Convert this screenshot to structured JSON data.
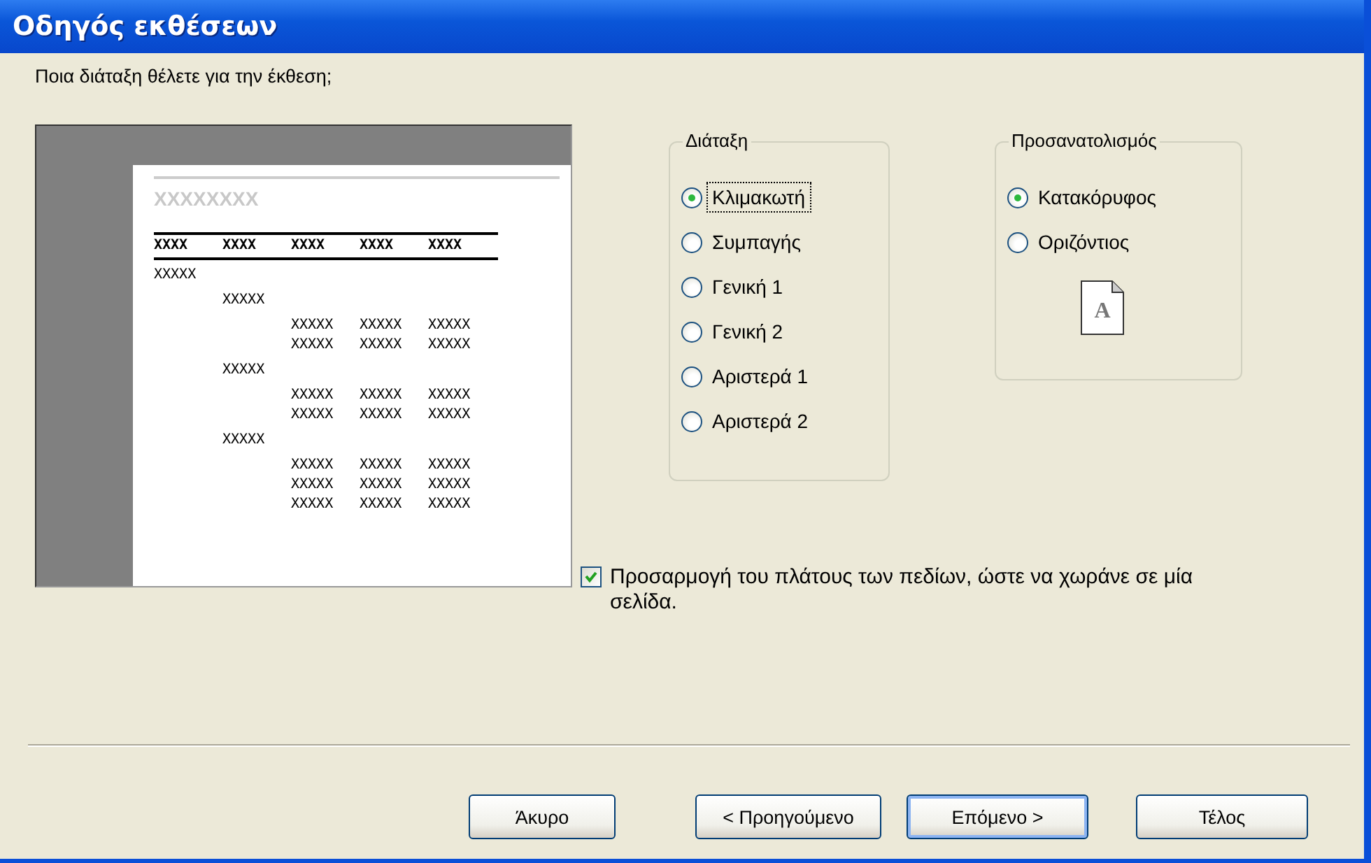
{
  "window": {
    "title": "Οδηγός εκθέσεων"
  },
  "question": "Ποια διάταξη θέλετε για την έκθεση;",
  "preview": {
    "title": "XXXXXXXX",
    "header": [
      "XXXX",
      "XXXX",
      "XXXX",
      "XXXX",
      "XXXX"
    ],
    "groups": [
      {
        "label": "XXXXX",
        "children": [
          {
            "label": "XXXXX",
            "rows": [
              [
                "XXXXX",
                "XXXXX",
                "XXXXX"
              ],
              [
                "XXXXX",
                "XXXXX",
                "XXXXX"
              ]
            ]
          },
          {
            "label": "XXXXX",
            "rows": [
              [
                "XXXXX",
                "XXXXX",
                "XXXXX"
              ],
              [
                "XXXXX",
                "XXXXX",
                "XXXXX"
              ]
            ]
          },
          {
            "label": "XXXXX",
            "rows": [
              [
                "XXXXX",
                "XXXXX",
                "XXXXX"
              ],
              [
                "XXXXX",
                "XXXXX",
                "XXXXX"
              ],
              [
                "XXXXX",
                "XXXXX",
                "XXXXX"
              ]
            ]
          }
        ]
      }
    ]
  },
  "layout": {
    "label": "Διάταξη",
    "options": [
      {
        "label": "Κλιμακωτή",
        "selected": true,
        "focused": true
      },
      {
        "label": "Συμπαγής",
        "selected": false,
        "focused": false
      },
      {
        "label": "Γενική 1",
        "selected": false,
        "focused": false
      },
      {
        "label": "Γενική 2",
        "selected": false,
        "focused": false
      },
      {
        "label": "Αριστερά 1",
        "selected": false,
        "focused": false
      },
      {
        "label": "Αριστερά 2",
        "selected": false,
        "focused": false
      }
    ]
  },
  "orientation": {
    "label": "Προσανατολισμός",
    "options": [
      {
        "label": "Κατακόρυφος",
        "selected": true,
        "focused": false
      },
      {
        "label": "Οριζόντιος",
        "selected": false,
        "focused": false
      }
    ],
    "page_letter": "A"
  },
  "fit_fields": {
    "label": "Προσαρμογή του πλάτους των πεδίων, ώστε να χωράνε σε μία σελίδα.",
    "checked": true
  },
  "buttons": [
    {
      "label": "Άκυρο",
      "default": false
    },
    {
      "label": "< Προηγούμενο",
      "default": false
    },
    {
      "label": "Επόμενο >",
      "default": true
    },
    {
      "label": "Τέλος",
      "default": false
    }
  ]
}
